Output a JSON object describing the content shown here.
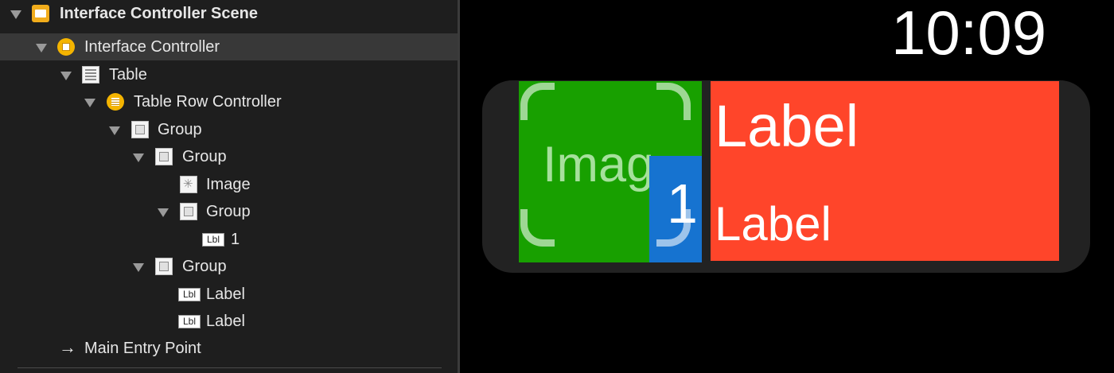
{
  "outline": {
    "scene": {
      "label": "Interface Controller Scene",
      "icon": "storyboard-scene-icon"
    },
    "controller": {
      "label": "Interface Controller",
      "icon": "interface-controller-icon"
    },
    "table": {
      "label": "Table",
      "icon": "table-icon"
    },
    "row_controller": {
      "label": "Table Row Controller",
      "icon": "row-controller-icon"
    },
    "group_outer": {
      "label": "Group",
      "icon": "group-icon"
    },
    "group_image": {
      "label": "Group",
      "icon": "group-icon"
    },
    "image": {
      "label": "Image",
      "icon": "image-icon"
    },
    "group_number": {
      "label": "Group",
      "icon": "group-icon"
    },
    "number_label": {
      "badge": "Lbl",
      "label": "1"
    },
    "group_labels": {
      "label": "Group",
      "icon": "group-icon"
    },
    "label_1": {
      "badge": "Lbl",
      "label": "Label"
    },
    "label_2": {
      "badge": "Lbl",
      "label": "Label"
    },
    "entry_point": {
      "arrow": "→",
      "label": "Main Entry Point"
    }
  },
  "canvas": {
    "clock": "10:09",
    "image_placeholder": "Imag",
    "number": "1",
    "label_top": "Label",
    "label_bottom": "Label"
  },
  "colors": {
    "image_group": "#18a000",
    "number_group": "#1673d0",
    "labels_group": "#ff452a",
    "selection": "#383838"
  }
}
